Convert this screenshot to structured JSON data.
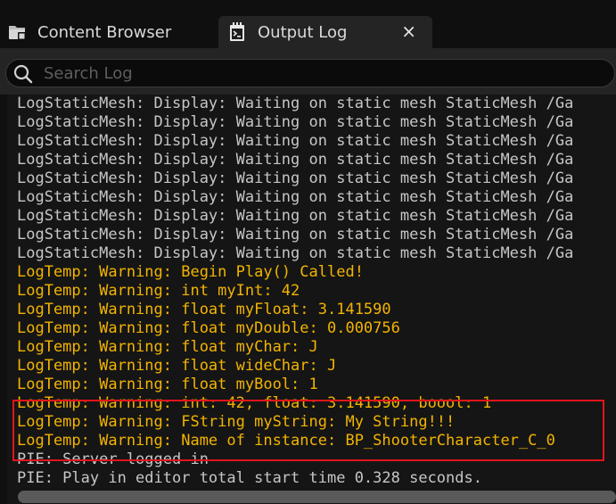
{
  "tabs": [
    {
      "label": "Content Browser",
      "icon": "folder-icon",
      "active": false
    },
    {
      "label": "Output Log",
      "icon": "terminal-log-icon",
      "active": true,
      "close_glyph": "×"
    }
  ],
  "search": {
    "placeholder": "Search Log",
    "value": ""
  },
  "log": {
    "lines": [
      {
        "text": "LogStaticMesh: Display: Waiting on static mesh StaticMesh /Ga",
        "level": "display"
      },
      {
        "text": "LogStaticMesh: Display: Waiting on static mesh StaticMesh /Ga",
        "level": "display"
      },
      {
        "text": "LogStaticMesh: Display: Waiting on static mesh StaticMesh /Ga",
        "level": "display"
      },
      {
        "text": "LogStaticMesh: Display: Waiting on static mesh StaticMesh /Ga",
        "level": "display"
      },
      {
        "text": "LogStaticMesh: Display: Waiting on static mesh StaticMesh /Ga",
        "level": "display"
      },
      {
        "text": "LogStaticMesh: Display: Waiting on static mesh StaticMesh /Ga",
        "level": "display"
      },
      {
        "text": "LogStaticMesh: Display: Waiting on static mesh StaticMesh /Ga",
        "level": "display"
      },
      {
        "text": "LogStaticMesh: Display: Waiting on static mesh StaticMesh /Ga",
        "level": "display"
      },
      {
        "text": "LogStaticMesh: Display: Waiting on static mesh StaticMesh /Ga",
        "level": "display"
      },
      {
        "text": "LogTemp: Warning: Begin Play() Called!",
        "level": "warning"
      },
      {
        "text": "LogTemp: Warning: int myInt: 42",
        "level": "warning"
      },
      {
        "text": "LogTemp: Warning: float myFloat: 3.141590",
        "level": "warning"
      },
      {
        "text": "LogTemp: Warning: float myDouble: 0.000756",
        "level": "warning"
      },
      {
        "text": "LogTemp: Warning: float myChar: J",
        "level": "warning"
      },
      {
        "text": "LogTemp: Warning: float wideChar: J",
        "level": "warning"
      },
      {
        "text": "LogTemp: Warning: float myBool: 1",
        "level": "warning"
      },
      {
        "text": "LogTemp: Warning: int: 42, float: 3.141590, boool: 1",
        "level": "warning"
      },
      {
        "text": "LogTemp: Warning: FString myString: My String!!!",
        "level": "warning"
      },
      {
        "text": "LogTemp: Warning: Name of instance: BP_ShooterCharacter_C_0",
        "level": "warning"
      },
      {
        "text": "PIE: Server logged in",
        "level": "display"
      },
      {
        "text": "PIE: Play in editor total start time 0.328 seconds.",
        "level": "display"
      }
    ]
  },
  "colors": {
    "display_text": "#c6c6c6",
    "warning_text": "#f2b400",
    "highlight_border": "#e3141b",
    "panel_background": "#151515"
  }
}
